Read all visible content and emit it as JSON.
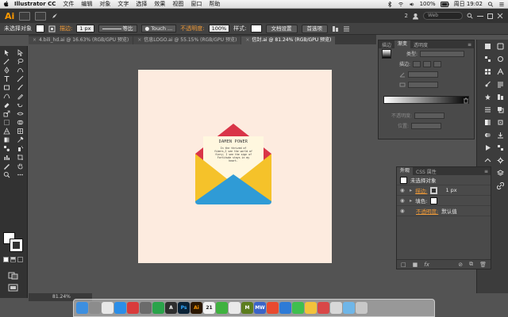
{
  "macbar": {
    "app_name": "Illustrator CC",
    "menus": [
      "文件",
      "编辑",
      "对象",
      "文字",
      "选择",
      "效果",
      "视图",
      "窗口",
      "帮助"
    ],
    "battery": "100%",
    "clock": "周日 19:02"
  },
  "appbar": {
    "logo": "Ai",
    "user_count": "2",
    "search_placeholder": "Web"
  },
  "controlbar": {
    "selection_status": "未选择对象",
    "stroke_label": "描边:",
    "stroke_value": "1 px",
    "stroke_style": "等比",
    "brush_value": "Touch ...",
    "opacity_label": "不透明度:",
    "opacity_value": "100%",
    "style_label": "样式:",
    "doc_setup_button": "文档设置",
    "preferences_button": "首选项"
  },
  "tabs": [
    {
      "label": "4.bili_hd.ai @ 16.63% (RGB/GPU 预览)",
      "active": false
    },
    {
      "label": "信息LOGO.ai @ 55.15% (RGB/GPU 预览)",
      "active": false
    },
    {
      "label": "信封.ai @ 81.24% (RGB/GPU 预览)",
      "active": true
    }
  ],
  "artwork": {
    "letter_title": "DAMEN POWER",
    "letter_lines": [
      "In the thrived of",
      "fibers,I see the world of",
      "fiery; I see the sign of",
      "Fortitude stays in my",
      "heart."
    ]
  },
  "statusbar": {
    "zoom": "81.24%"
  },
  "gradient_panel": {
    "tabs": [
      "描边",
      "渐变",
      "透明度"
    ],
    "type_label": "类型:",
    "stroke_label": "描边:",
    "opacity_label": "不透明度:",
    "position_label": "位置:"
  },
  "appearance_panel": {
    "tabs": [
      "外观",
      "CSS 属性"
    ],
    "title": "未选择对象",
    "stroke_label": "描边:",
    "stroke_value": "1 px",
    "fill_label": "填色:",
    "opacity_label": "不透明度:",
    "opacity_value": "默认值"
  },
  "dock": {
    "apps": [
      {
        "name": "Finder",
        "color": "#3d8fe0",
        "glyph": ""
      },
      {
        "name": "Launchpad",
        "color": "#8c8c8c",
        "glyph": ""
      },
      {
        "name": "Chrome",
        "color": "#e8e8e8",
        "glyph": ""
      },
      {
        "name": "Safari",
        "color": "#2b8ee8",
        "glyph": ""
      },
      {
        "name": "Netease",
        "color": "#d93b3b",
        "glyph": ""
      },
      {
        "name": "Evernote",
        "color": "#6b6b6b",
        "glyph": ""
      },
      {
        "name": "Green",
        "color": "#2aa34a",
        "glyph": ""
      },
      {
        "name": "Font",
        "color": "#2e2e2e",
        "glyph": "A"
      },
      {
        "name": "Photoshop",
        "color": "#0a2236",
        "glyph": "Ps"
      },
      {
        "name": "Illustrator",
        "color": "#2b1700",
        "glyph": "Ai"
      },
      {
        "name": "Calendar",
        "color": "#f2f2f2",
        "glyph": "21"
      },
      {
        "name": "WeChat",
        "color": "#3fb23f",
        "glyph": ""
      },
      {
        "name": "QQ",
        "color": "#eaeaea",
        "glyph": ""
      },
      {
        "name": "M",
        "color": "#5c7d1e",
        "glyph": "M"
      },
      {
        "name": "MW",
        "color": "#3a64c8",
        "glyph": "MW"
      },
      {
        "name": "Weibo",
        "color": "#e94a2e",
        "glyph": ""
      },
      {
        "name": "Mail",
        "color": "#2e7bd6",
        "glyph": ""
      },
      {
        "name": "Messages",
        "color": "#3fbf4f",
        "glyph": ""
      },
      {
        "name": "Photos",
        "color": "#f3c33b",
        "glyph": ""
      },
      {
        "name": "Notes",
        "color": "#d94747",
        "glyph": ""
      },
      {
        "name": "Preview",
        "color": "#d8d8d8",
        "glyph": ""
      },
      {
        "name": "Folder",
        "color": "#6fb6e8",
        "glyph": ""
      },
      {
        "name": "Trash",
        "color": "#c8c8c8",
        "glyph": ""
      }
    ]
  },
  "colors": {
    "artboard": "#fdebdf",
    "envelope_red": "#d93548",
    "envelope_yellow": "#f5c22a",
    "envelope_blue": "#2f9bd6",
    "letter_paper": "#fff7df",
    "accent_orange": "#f09a37"
  }
}
